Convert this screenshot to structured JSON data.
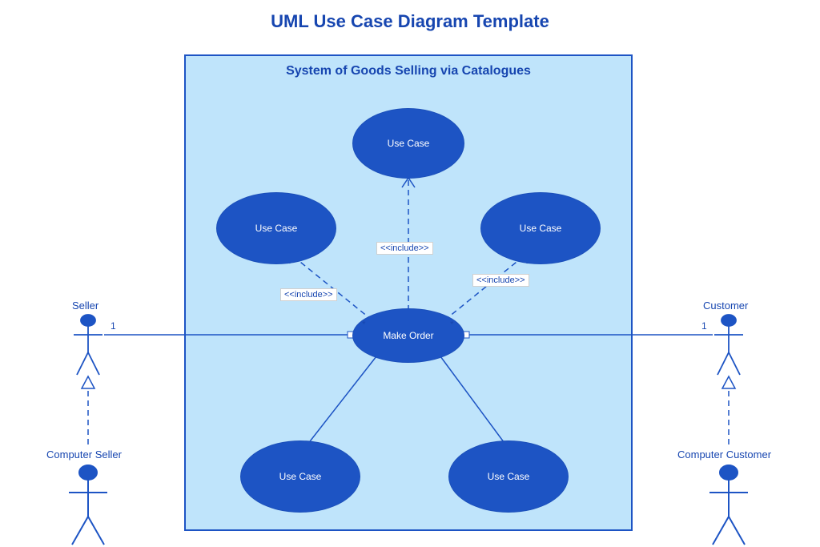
{
  "title": "UML Use Case Diagram Template",
  "system": {
    "name": "System of Goods Selling via Catalogues"
  },
  "useCases": {
    "top": {
      "label": "Use Case"
    },
    "left": {
      "label": "Use Case"
    },
    "right": {
      "label": "Use Case"
    },
    "center": {
      "label": "Make Order"
    },
    "bottomL": {
      "label": "Use Case"
    },
    "bottomR": {
      "label": "Use Case"
    }
  },
  "includeLabel": "<<include>>",
  "actors": {
    "seller": {
      "name": "Seller"
    },
    "computerSeller": {
      "name": "Computer Seller"
    },
    "customer": {
      "name": "Customer"
    },
    "computerCustomer": {
      "name": "Computer Customer"
    }
  },
  "multiplicity": {
    "sellerEnd": "1",
    "centerLeft": "*",
    "centerRight": "*",
    "customerEnd": "1"
  }
}
